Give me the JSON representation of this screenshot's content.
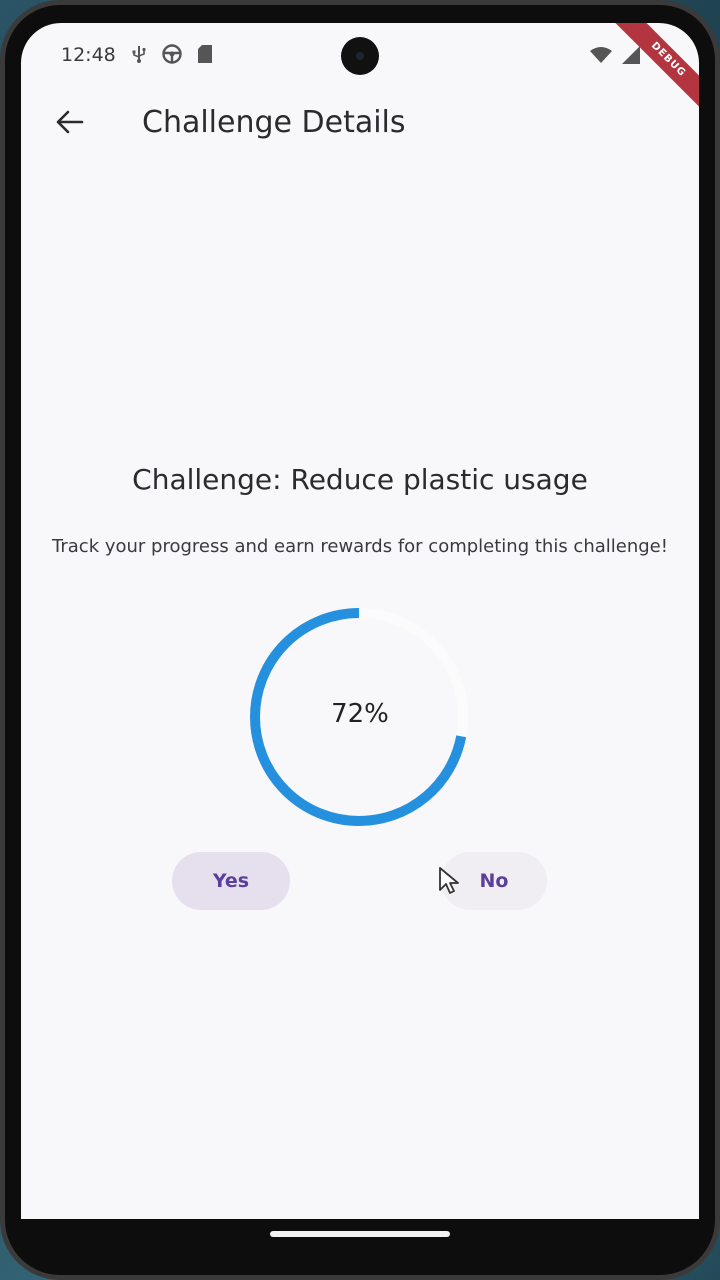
{
  "statusbar": {
    "time": "12:48",
    "left_icons": [
      "usb-icon",
      "steering-wheel-icon",
      "sd-card-icon"
    ],
    "right_icons": [
      "wifi-icon",
      "signal-icon"
    ],
    "debug_label": "DEBUG"
  },
  "appbar": {
    "title": "Challenge Details",
    "back_icon": "arrow-back-icon"
  },
  "challenge": {
    "title": "Challenge: Reduce plastic usage",
    "description": "Track your progress and earn rewards for completing this challenge!",
    "progress_percent": 72,
    "progress_label": "72%"
  },
  "actions": {
    "yes_label": "Yes",
    "no_label": "No"
  },
  "colors": {
    "progress": "#2591de",
    "button_text": "#5b3f9a",
    "background": "#f8f7fa"
  }
}
